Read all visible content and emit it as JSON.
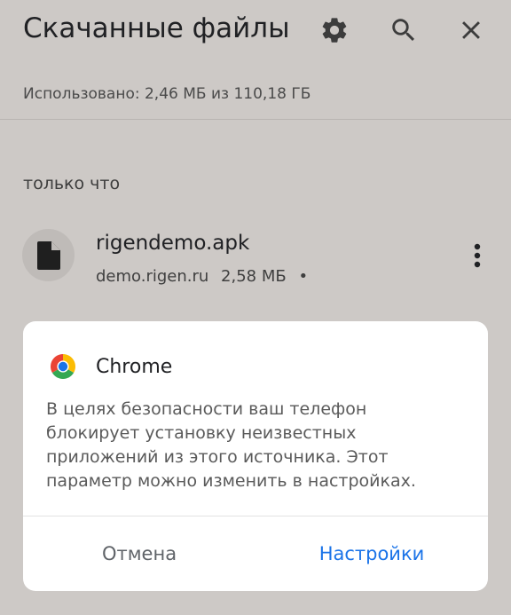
{
  "header": {
    "title": "Скачанные файлы",
    "icons": [
      "gear-icon",
      "search-icon",
      "close-icon"
    ]
  },
  "storage": {
    "text": "Использовано: 2,46 МБ из 110,18 ГБ"
  },
  "section": {
    "label": "только что"
  },
  "file": {
    "name": "rigendemo.apk",
    "source": "demo.rigen.ru",
    "size": "2,58 МБ",
    "separator": "•",
    "icon": "document-icon"
  },
  "dialog": {
    "app_name": "Chrome",
    "app_icon": "chrome-icon",
    "message": "В целях безопасности ваш телефон блокирует установку неизвестных приложений из этого источника. Этот параметр можно изменить в настройках.",
    "cancel_label": "Отмена",
    "settings_label": "Настройки"
  },
  "colors": {
    "background": "#cdc9c6",
    "dialog": "#ffffff",
    "accent": "#1a73e8"
  }
}
